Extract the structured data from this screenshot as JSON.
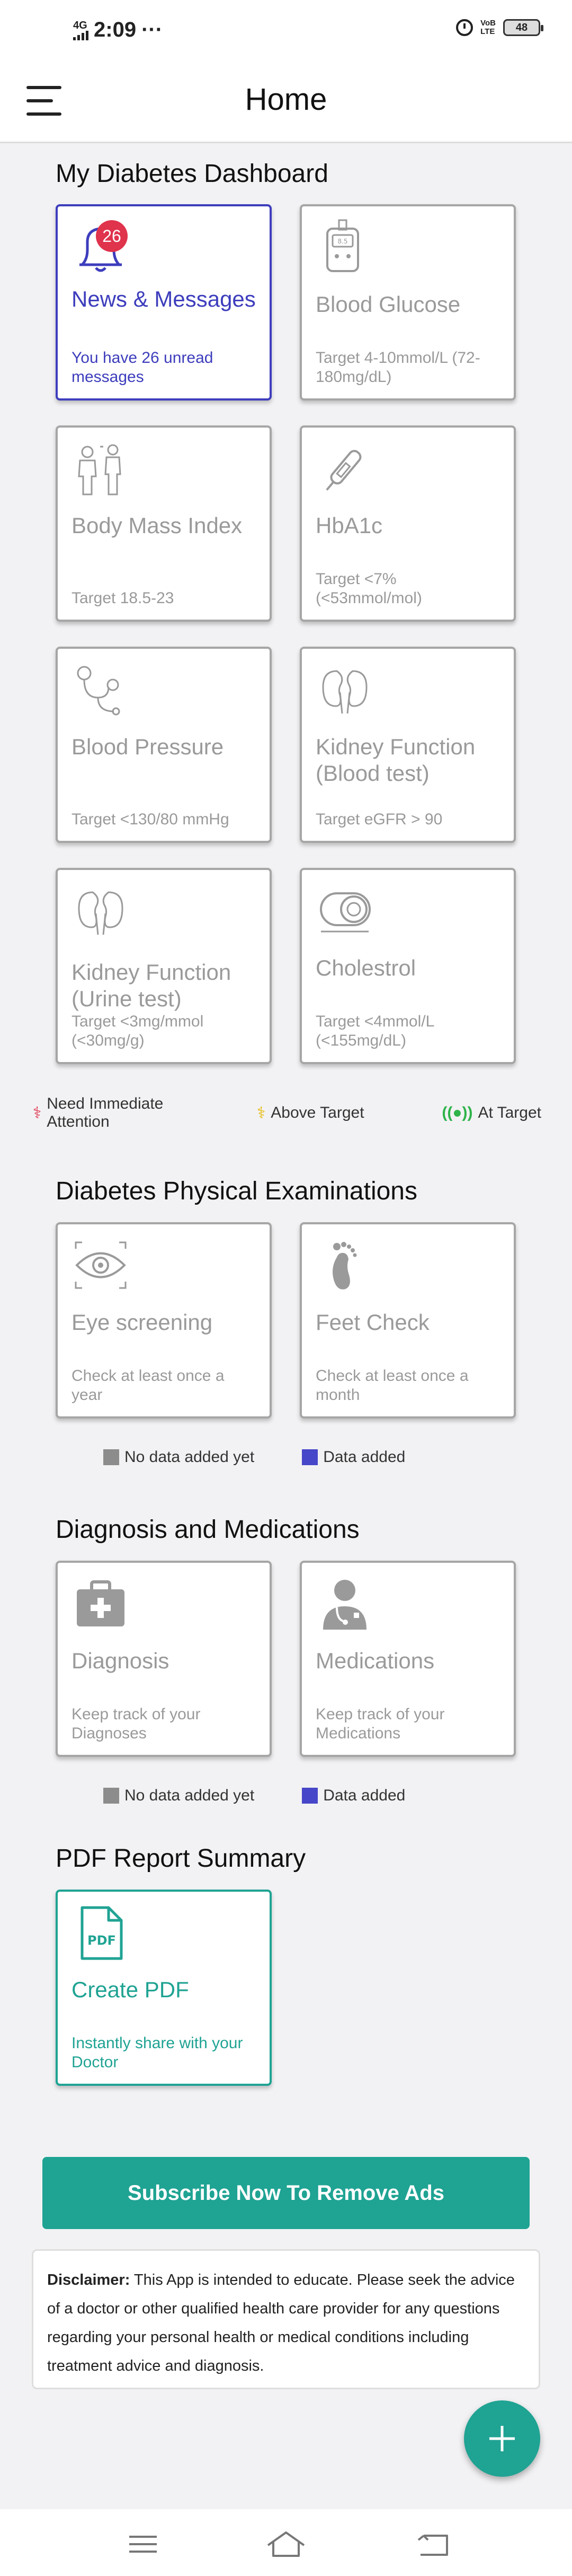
{
  "status_bar": {
    "time": "2:09",
    "dots": "···",
    "network": "4G",
    "volte": "VoB",
    "lte": "LTE",
    "battery": "48"
  },
  "header": {
    "title": "Home"
  },
  "dashboard": {
    "title": "My Diabetes Dashboard",
    "cards": [
      {
        "title": "News & Messages",
        "subtitle": "You have 26 unread messages",
        "badge": "26",
        "icon": "bell-icon"
      },
      {
        "title": "Blood Glucose",
        "subtitle": "Target 4-10mmol/L (72-180mg/dL)",
        "icon": "glucometer-icon"
      },
      {
        "title": "Body Mass Index",
        "subtitle": "Target 18.5-23",
        "icon": "body-mass-icon"
      },
      {
        "title": "HbA1c",
        "subtitle": "Target <7% (<53mmol/mol)",
        "icon": "test-strip-icon"
      },
      {
        "title": "Blood Pressure",
        "subtitle": "Target <130/80 mmHg",
        "icon": "stethoscope-icon"
      },
      {
        "title": "Kidney Function (Blood test)",
        "subtitle": "Target eGFR > 90",
        "icon": "kidney-icon"
      },
      {
        "title": "Kidney Function (Urine test)",
        "subtitle": "Target <3mg/mmol (<30mg/g)",
        "icon": "kidney-icon"
      },
      {
        "title": "Cholestrol",
        "subtitle": "Target <4mmol/L (<155mg/dL)",
        "icon": "artery-icon"
      }
    ],
    "legend": {
      "immediate": "Need Immediate Attention",
      "above": "Above Target",
      "at": "At Target"
    }
  },
  "physical": {
    "title": "Diabetes Physical Examinations",
    "cards": [
      {
        "title": "Eye screening",
        "subtitle": "Check at least once a year",
        "icon": "eye-icon"
      },
      {
        "title": "Feet Check",
        "subtitle": "Check at least once a month",
        "icon": "foot-icon"
      }
    ],
    "legend": {
      "no_data": "No data added yet",
      "data": "Data added"
    }
  },
  "diagnosis": {
    "title": "Diagnosis and Medications",
    "cards": [
      {
        "title": "Diagnosis",
        "subtitle": "Keep track of your Diagnoses",
        "icon": "medical-kit-icon"
      },
      {
        "title": "Medications",
        "subtitle": "Keep track of your Medications",
        "icon": "doctor-icon"
      }
    ],
    "legend": {
      "no_data": "No data added yet",
      "data": "Data added"
    }
  },
  "pdf": {
    "title": "PDF Report Summary",
    "card": {
      "title": "Create PDF",
      "subtitle": "Instantly share with your Doctor",
      "icon_text": "PDF"
    }
  },
  "subscribe_label": "Subscribe Now To Remove Ads",
  "disclaimer": {
    "label": "Disclaimer:",
    "text": "This App is intended to educate. Please seek the advice of a doctor or other qualified health care provider for any questions regarding your personal health or medical conditions including treatment advice and diagnosis."
  },
  "colors": {
    "accent": "#1fa393",
    "active": "#3d3dbd",
    "badge": "#e0334c",
    "inactive": "#9a9a9a",
    "no_data": "#8c8c8c",
    "data_added": "#4747c9",
    "attention": "#e0334c",
    "above": "#e6b800",
    "at_target": "#2fb34a"
  }
}
